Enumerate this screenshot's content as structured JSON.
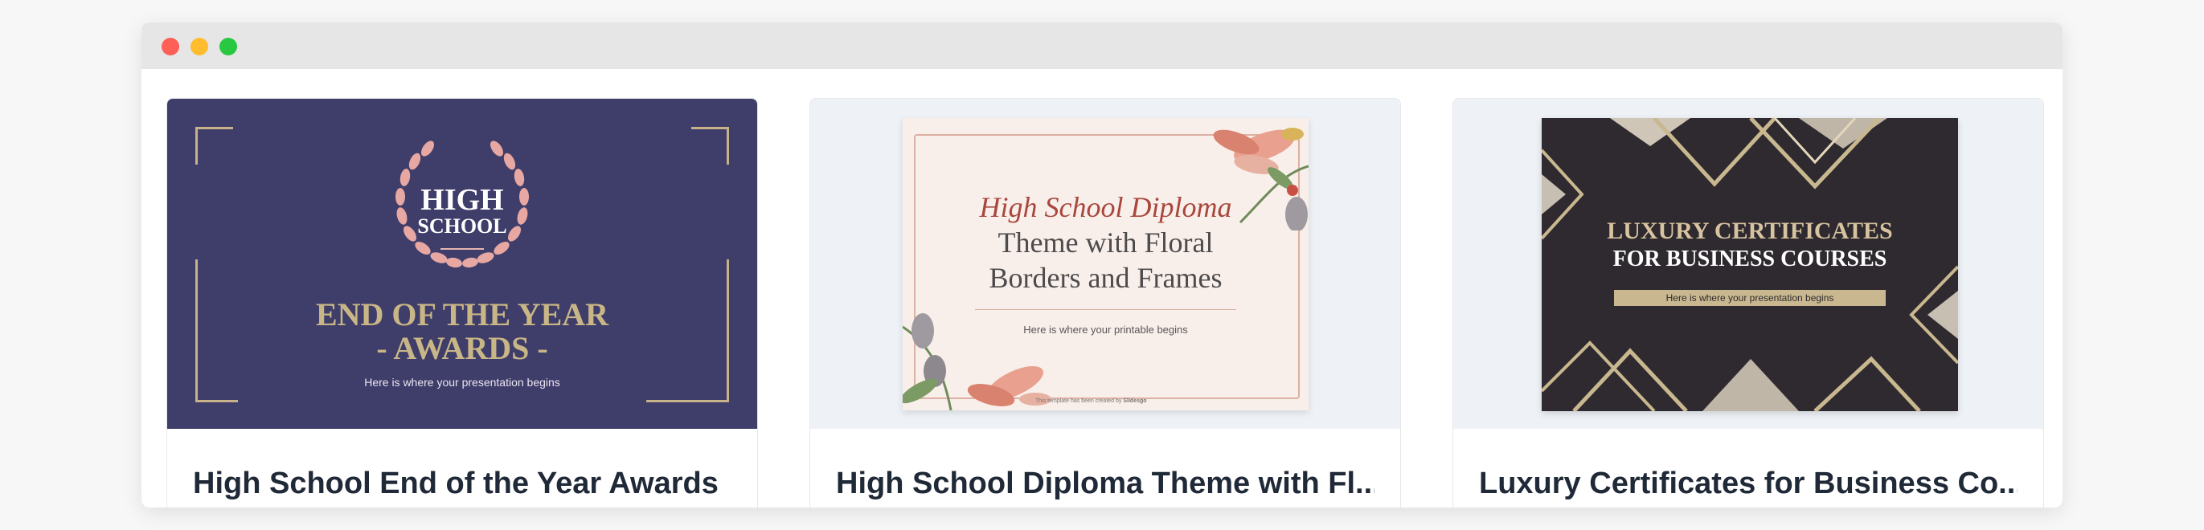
{
  "window": {
    "controls": [
      "close",
      "minimize",
      "maximize"
    ],
    "colors": {
      "close": "#fe5f57",
      "minimize": "#febc2e",
      "maximize": "#28c840"
    }
  },
  "cards": [
    {
      "title": "High School End of the Year Awards",
      "thumbnail": {
        "badge_line1": "HIGH",
        "badge_line2": "SCHOOL",
        "heading_line1": "END OF THE YEAR",
        "heading_line2": "- AWARDS -",
        "subtitle": "Here is where your presentation begins",
        "bg_color": "#3f3d69",
        "accent_color": "#c9b687"
      }
    },
    {
      "title": "High School Diploma Theme with Fl...",
      "thumbnail": {
        "heading_line1": "High School Diploma",
        "heading_line2": "Theme with Floral",
        "heading_line3": "Borders and Frames",
        "subtitle": "Here is where your printable begins",
        "credit_text": "This template has been created by",
        "credit_brand": "Slidesgo",
        "bg_color": "#f8efea",
        "accent_color": "#a9473d"
      }
    },
    {
      "title": "Luxury Certificates for Business Co...",
      "thumbnail": {
        "heading_line1": "LUXURY CERTIFICATES",
        "heading_line2": "FOR BUSINESS COURSES",
        "subtitle": "Here is where your presentation begins",
        "bg_color": "#2e2a2f",
        "accent_color": "#c9b88f"
      }
    }
  ]
}
